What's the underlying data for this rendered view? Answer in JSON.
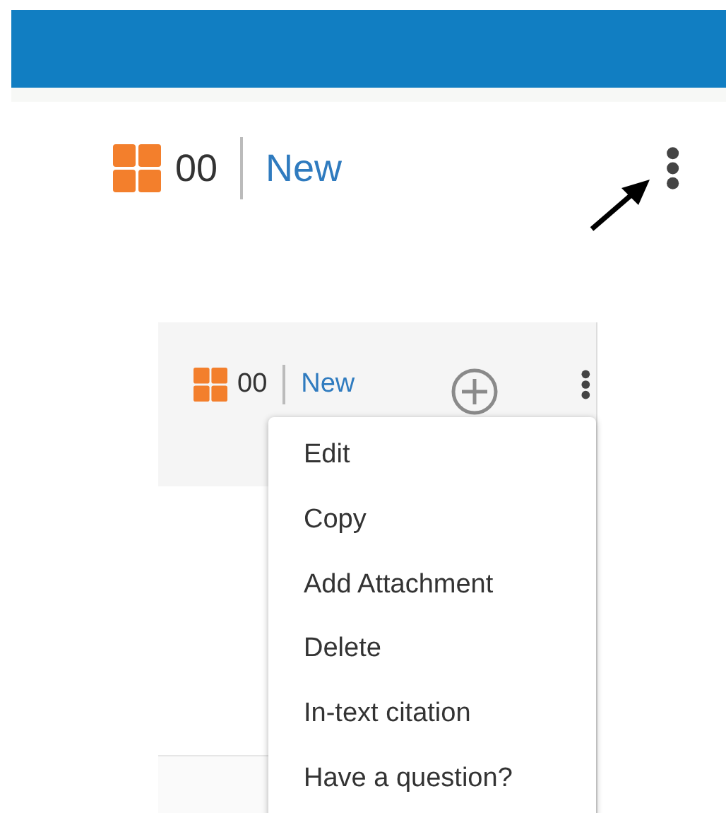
{
  "top_toolbar": {
    "count": "00",
    "status": "New"
  },
  "panel_toolbar": {
    "count": "00",
    "status": "New"
  },
  "menu": {
    "items": [
      {
        "label": "Edit"
      },
      {
        "label": "Copy"
      },
      {
        "label": "Add Attachment"
      },
      {
        "label": "Delete"
      },
      {
        "label": "In-text citation"
      },
      {
        "label": "Have a question?"
      }
    ]
  }
}
